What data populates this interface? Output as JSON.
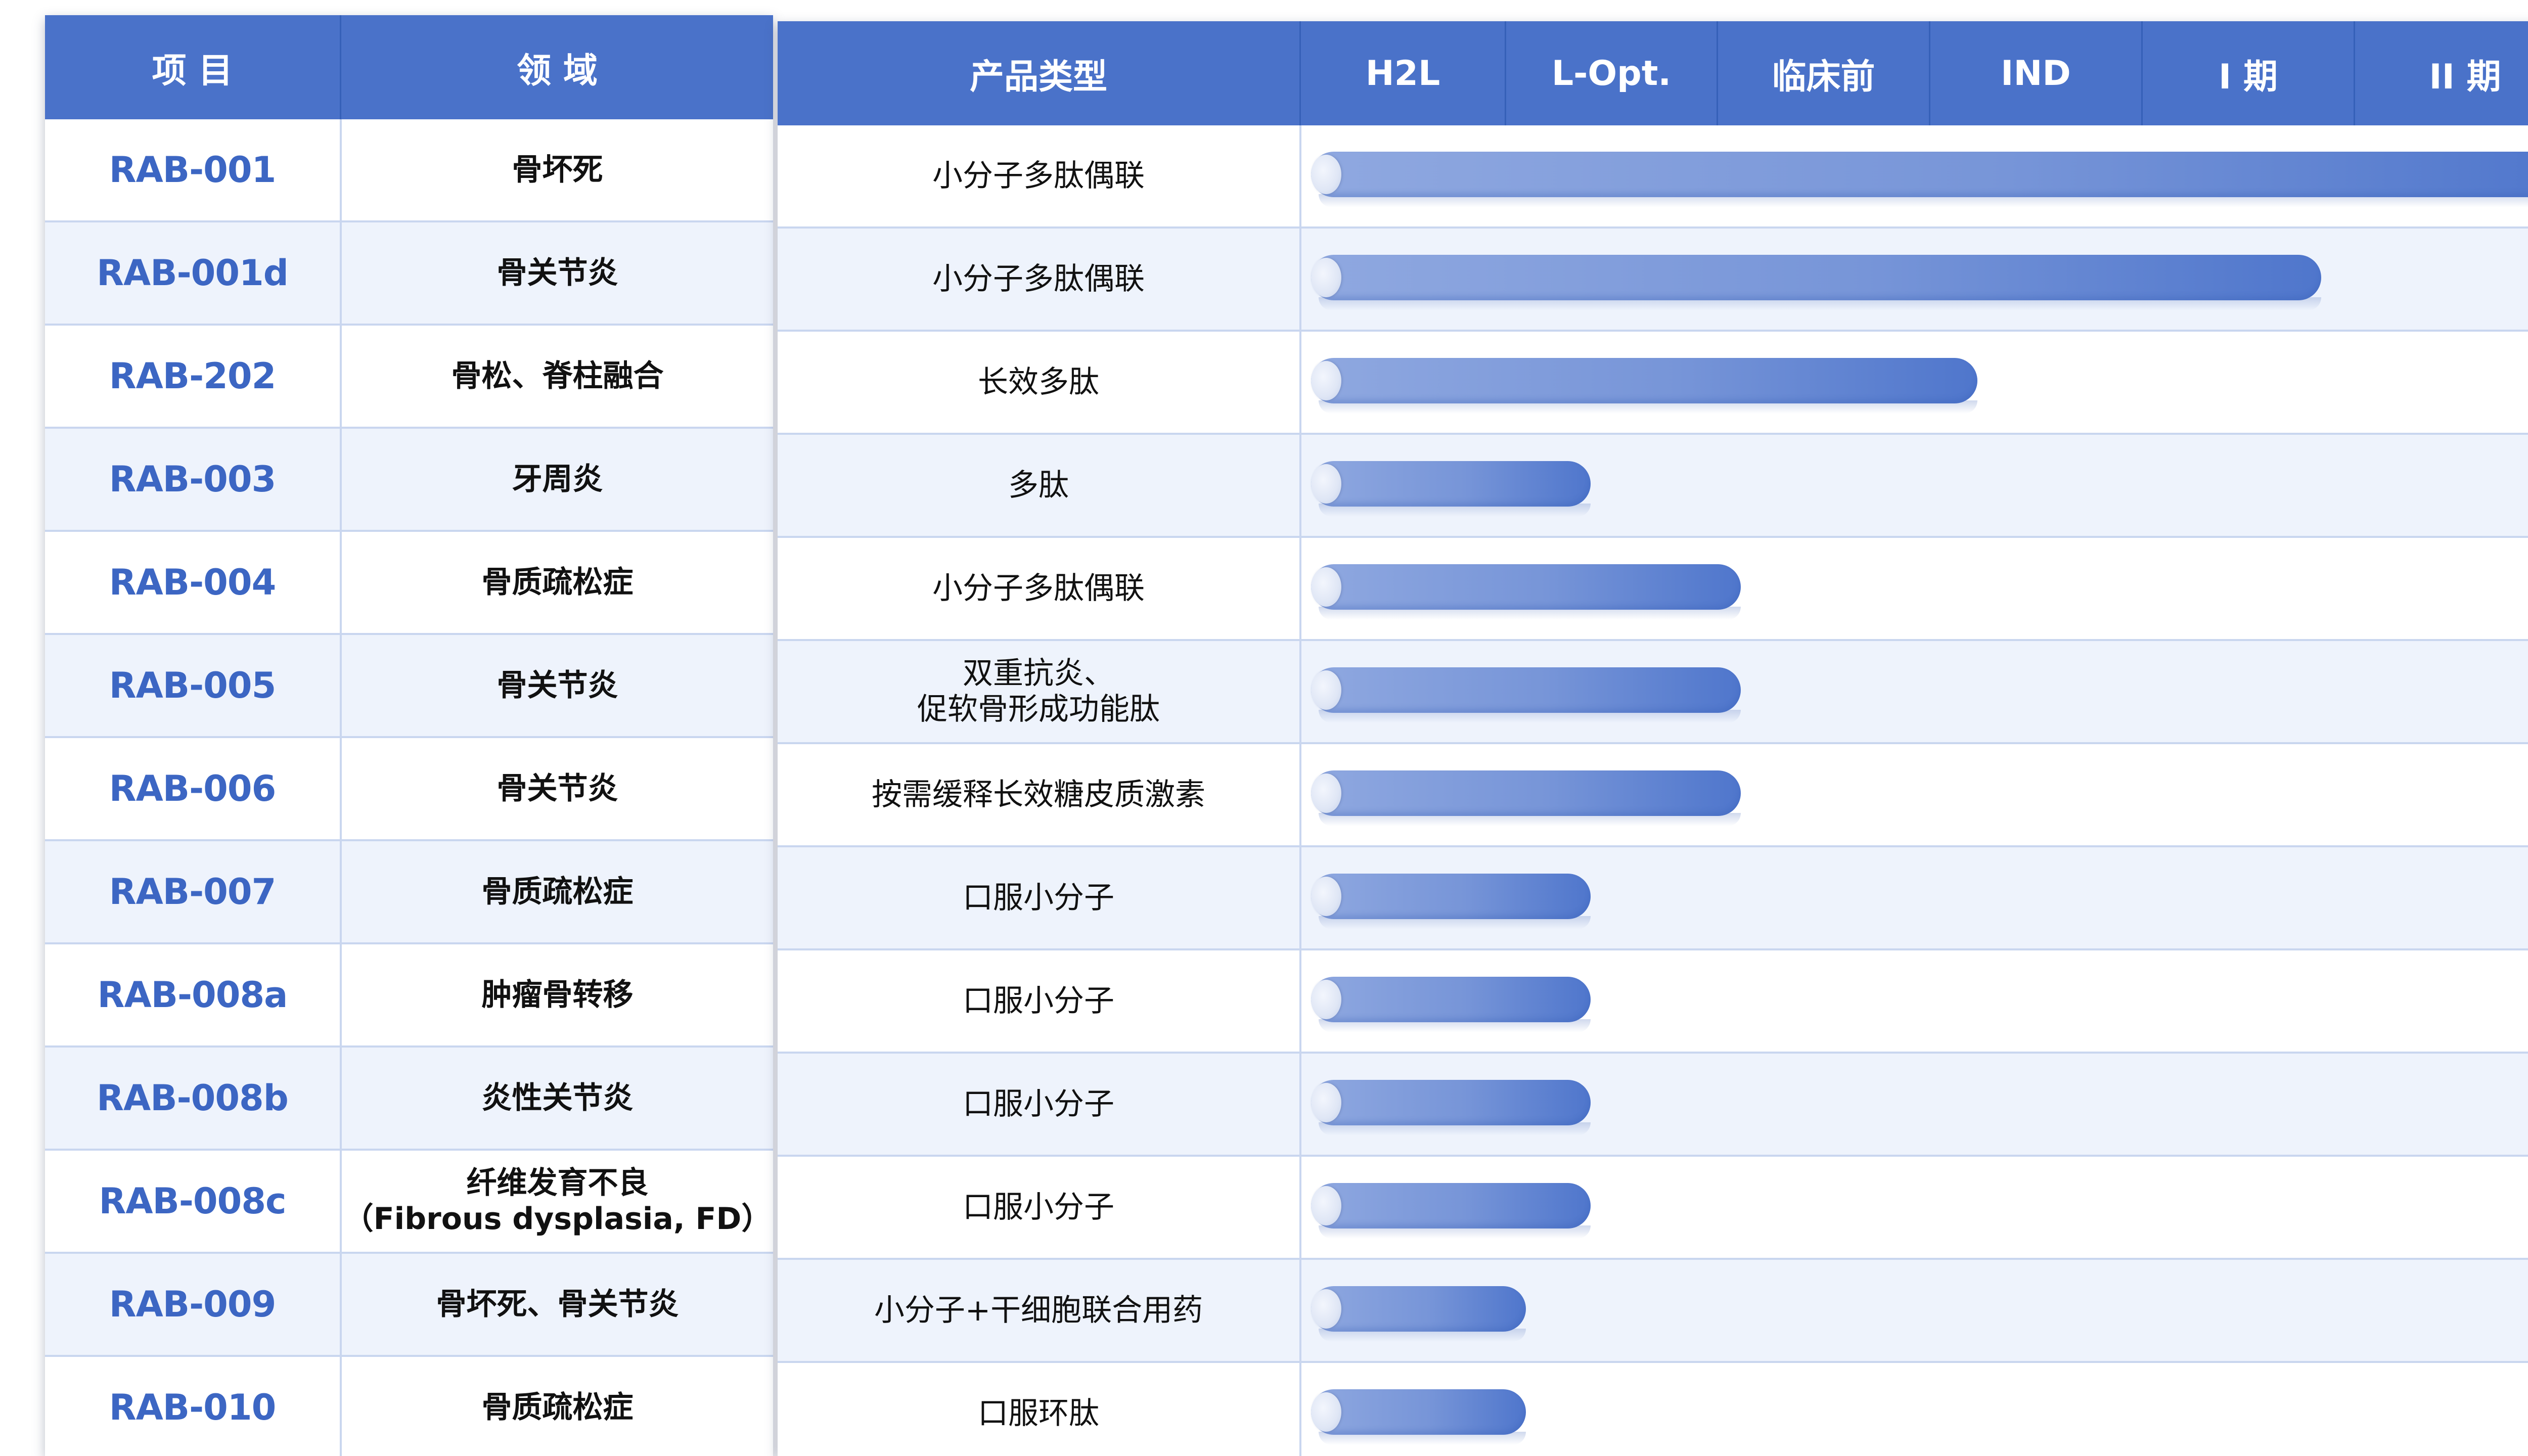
{
  "columns": {
    "project": "项 目",
    "field": "领 域",
    "product_type": "产品类型",
    "stages": [
      "H2L",
      "L-Opt.",
      "临床前",
      "IND",
      "I 期",
      "II 期"
    ]
  },
  "chart_data": {
    "type": "bar",
    "orientation": "horizontal",
    "xlabel": "",
    "ylabel": "",
    "stages": [
      "H2L",
      "L-Opt.",
      "临床前",
      "IND",
      "I 期",
      "II 期"
    ],
    "xlim": [
      0,
      6
    ],
    "categories": [
      "RAB-001",
      "RAB-001d",
      "RAB-202",
      "RAB-003",
      "RAB-004",
      "RAB-005",
      "RAB-006",
      "RAB-007",
      "RAB-008a",
      "RAB-008b",
      "RAB-008c",
      "RAB-009",
      "RAB-010"
    ],
    "values": [
      5.9,
      4.7,
      3.1,
      1.3,
      2.0,
      2.0,
      2.0,
      1.3,
      1.3,
      1.3,
      1.3,
      1.0,
      1.0
    ],
    "color": "#4a72c9"
  },
  "rows": [
    {
      "code": "RAB-001",
      "field": "骨坏死",
      "type": "小分子多肽偶联"
    },
    {
      "code": "RAB-001d",
      "field": "骨关节炎",
      "type": "小分子多肽偶联"
    },
    {
      "code": "RAB-202",
      "field": "骨松、脊柱融合",
      "type": "长效多肽"
    },
    {
      "code": "RAB-003",
      "field": "牙周炎",
      "type": "多肽"
    },
    {
      "code": "RAB-004",
      "field": "骨质疏松症",
      "type": "小分子多肽偶联"
    },
    {
      "code": "RAB-005",
      "field": "骨关节炎",
      "type": "双重抗炎、\n促软骨形成功能肽"
    },
    {
      "code": "RAB-006",
      "field": "骨关节炎",
      "type": "按需缓释长效糖皮质激素"
    },
    {
      "code": "RAB-007",
      "field": "骨质疏松症",
      "type": "口服小分子"
    },
    {
      "code": "RAB-008a",
      "field": "肿瘤骨转移",
      "type": "口服小分子"
    },
    {
      "code": "RAB-008b",
      "field": "炎性关节炎",
      "type": "口服小分子"
    },
    {
      "code": "RAB-008c",
      "field": "纤维发育不良\n（Fibrous dysplasia, FD）",
      "type": "口服小分子"
    },
    {
      "code": "RAB-009",
      "field": "骨坏死、骨关节炎",
      "type": "小分子+干细胞联合用药"
    },
    {
      "code": "RAB-010",
      "field": "骨质疏松症",
      "type": "口服环肽"
    }
  ]
}
